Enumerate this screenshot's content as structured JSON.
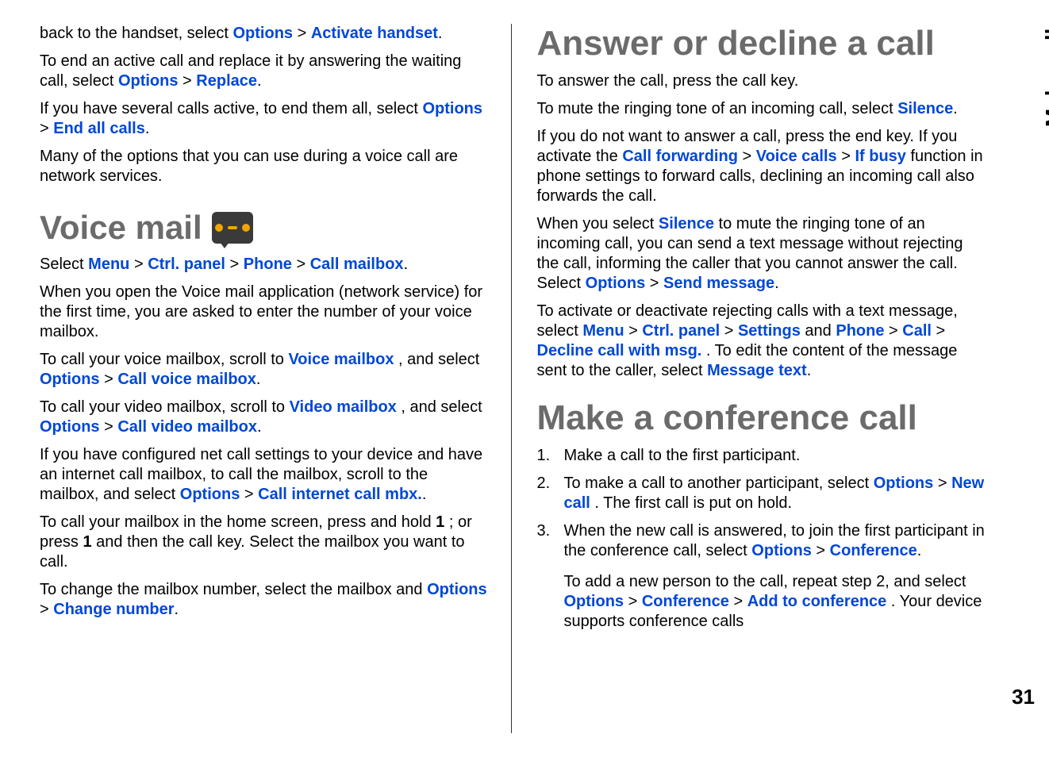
{
  "sideLabel": "Make calls",
  "pageNumber": "31",
  "left": {
    "p1_a": "back to the handset, select ",
    "p1_opt": "Options",
    "p1_activate": "Activate handset",
    "p2_a": "To end an active call and replace it by answering the waiting call, select ",
    "p2_opt": "Options",
    "p2_replace": "Replace",
    "p3_a": "If you have several calls active, to end them all, select ",
    "p3_opt": "Options",
    "p3_end": "End all calls",
    "p4": "Many of the options that you can use during a voice call are network services.",
    "h_voicemail": "Voice mail",
    "p5_a": "Select ",
    "p5_menu": "Menu",
    "p5_ctrl": "Ctrl. panel",
    "p5_phone": "Phone",
    "p5_mailbox": "Call mailbox",
    "p6": "When you open the Voice mail application (network service) for the first time, you are asked to enter the number of your voice mailbox.",
    "p7_a": "To call your voice mailbox, scroll to ",
    "p7_vm": "Voice mailbox",
    "p7_b": ", and select ",
    "p7_opt": "Options",
    "p7_call": "Call voice mailbox",
    "p8_a": "To call your video mailbox, scroll to ",
    "p8_vm": "Video mailbox",
    "p8_b": ", and select ",
    "p8_opt": "Options",
    "p8_call": "Call video mailbox",
    "p9_a": "If you have configured net call settings to your device and have an internet call mailbox, to call the mailbox, scroll to the mailbox, and select ",
    "p9_opt": "Options",
    "p9_call": "Call internet call mbx.",
    "p10_a": "To call your mailbox in the home screen, press and hold ",
    "p10_1a": "1",
    "p10_b": "; or press ",
    "p10_1b": "1",
    "p10_c": " and then the call key. Select the mailbox you want to call.",
    "p11_a": "To change the mailbox number, select the mailbox and ",
    "p11_opt": "Options",
    "p11_change": "Change number"
  },
  "right": {
    "h_answer": "Answer or decline a call",
    "p1": "To answer the call, press the call key.",
    "p2_a": "To mute the ringing tone of an incoming call, select ",
    "p2_silence": "Silence",
    "p3_a": "If you do not want to answer a call, press the end key. If you activate the ",
    "p3_cf": "Call forwarding",
    "p3_vc": "Voice calls",
    "p3_ib": "If busy",
    "p3_b": " function in phone settings to forward calls, declining an incoming call also forwards the call.",
    "p4_a": "When you select ",
    "p4_silence": "Silence",
    "p4_b": " to mute the ringing tone of an incoming call, you can send a text message without rejecting the call, informing the caller that you cannot answer the call. Select ",
    "p4_opt": "Options",
    "p4_send": "Send message",
    "p5_a": "To activate or deactivate rejecting calls with a text message, select ",
    "p5_menu": "Menu",
    "p5_ctrl": "Ctrl. panel",
    "p5_settings": "Settings",
    "p5_b": " and ",
    "p5_phone": "Phone",
    "p5_call": "Call",
    "p5_decline": "Decline call with msg.",
    "p5_c": ". To edit the content of the message sent to the caller, select ",
    "p5_msgtext": "Message text",
    "h_conf": "Make a conference call",
    "li1": "Make a call to the first participant.",
    "li2_a": "To make a call to another participant, select ",
    "li2_opt": "Options",
    "li2_new": "New call",
    "li2_b": ". The first call is put on hold.",
    "li3_a": "When the new call is answered, to join the first participant in the conference call, select ",
    "li3_opt": "Options",
    "li3_conf": "Conference",
    "li3_sub_a": "To add a new person to the call, repeat step 2, and select ",
    "li3_sub_opt": "Options",
    "li3_sub_conf": "Conference",
    "li3_sub_add": "Add to conference",
    "li3_sub_b": ". Your device supports conference calls"
  }
}
